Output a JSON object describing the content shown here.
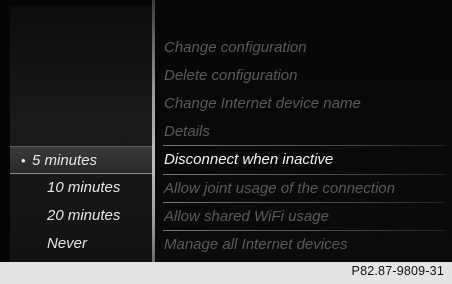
{
  "submenu": {
    "options": [
      {
        "label": "5 minutes",
        "selected": true,
        "bullet": "•"
      },
      {
        "label": "10 minutes",
        "selected": false
      },
      {
        "label": "20 minutes",
        "selected": false
      },
      {
        "label": "Never",
        "selected": false
      }
    ]
  },
  "menu": {
    "items": [
      {
        "label": "Change configuration",
        "active": false
      },
      {
        "label": "Delete configuration",
        "active": false
      },
      {
        "label": "Change Internet device name",
        "active": false
      },
      {
        "label": "Details",
        "active": false
      },
      {
        "label": "Disconnect when inactive",
        "active": true
      },
      {
        "label": "Allow joint usage of the connection",
        "active": false
      },
      {
        "label": "Allow shared WiFi usage",
        "active": false
      },
      {
        "label": "Manage all Internet devices",
        "active": false
      }
    ]
  },
  "footer": {
    "reference_code": "P82.87-9809-31"
  },
  "colors": {
    "screen_bg": "#050505",
    "active_text": "#f2f2f2",
    "inactive_text": "#5a5a5a",
    "footer_bg": "#e4e4e4"
  }
}
